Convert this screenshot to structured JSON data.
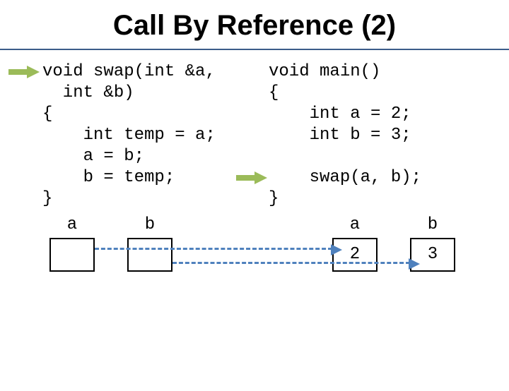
{
  "title": "Call By Reference (2)",
  "code_left": "void swap(int &a,\n  int &b)\n{\n    int temp = a;\n    a = b;\n    b = temp;\n}",
  "code_right": "void main()\n{\n    int a = 2;\n    int b = 3;\n\n    swap(a, b);\n}",
  "vars": {
    "left_a_label": "a",
    "left_b_label": "b",
    "left_a_value": "",
    "left_b_value": "",
    "right_a_label": "a",
    "right_b_label": "b",
    "right_a_value": "2",
    "right_b_value": "3"
  },
  "colors": {
    "marker": "#9bbb59",
    "dash": "#4f81bd"
  }
}
